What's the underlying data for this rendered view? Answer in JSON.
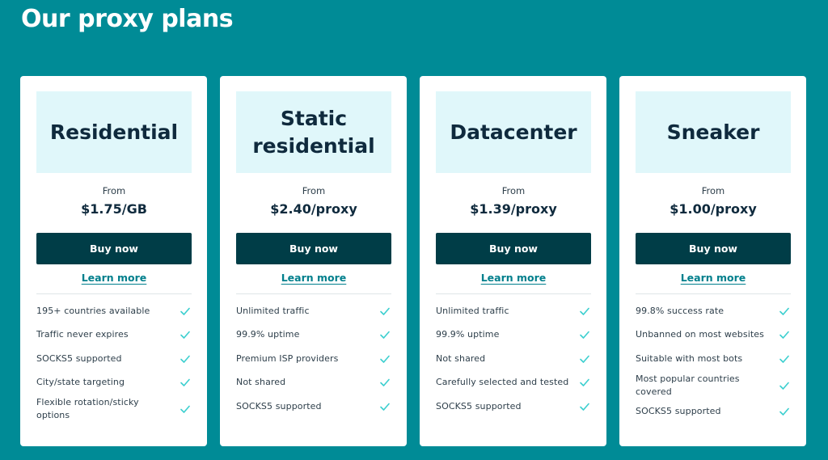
{
  "page": {
    "title": "Our proxy plans"
  },
  "colors": {
    "background": "#008b96",
    "card_header": "#e0f7fa",
    "button": "#003d47",
    "link": "#007f8c",
    "check": "#3ccfcf"
  },
  "plans": [
    {
      "name": "Residential",
      "from_label": "From",
      "price": "$1.75/GB",
      "buy_label": "Buy now",
      "learn_label": "Learn more",
      "features": [
        "195+ countries available",
        "Traffic never expires",
        "SOCKS5 supported",
        "City/state targeting",
        "Flexible rotation/sticky options"
      ]
    },
    {
      "name": "Static residential",
      "from_label": "From",
      "price": "$2.40/proxy",
      "buy_label": "Buy now",
      "learn_label": "Learn more",
      "features": [
        "Unlimited traffic",
        "99.9% uptime",
        "Premium ISP providers",
        "Not shared",
        "SOCKS5 supported"
      ]
    },
    {
      "name": "Datacenter",
      "from_label": "From",
      "price": "$1.39/proxy",
      "buy_label": "Buy now",
      "learn_label": "Learn more",
      "features": [
        "Unlimited traffic",
        "99.9% uptime",
        "Not shared",
        "Carefully selected and tested",
        "SOCKS5 supported"
      ]
    },
    {
      "name": "Sneaker",
      "from_label": "From",
      "price": "$1.00/proxy",
      "buy_label": "Buy now",
      "learn_label": "Learn more",
      "features": [
        "99.8% success rate",
        "Unbanned on most websites",
        "Suitable with most bots",
        "Most popular countries covered",
        "SOCKS5 supported"
      ]
    }
  ]
}
